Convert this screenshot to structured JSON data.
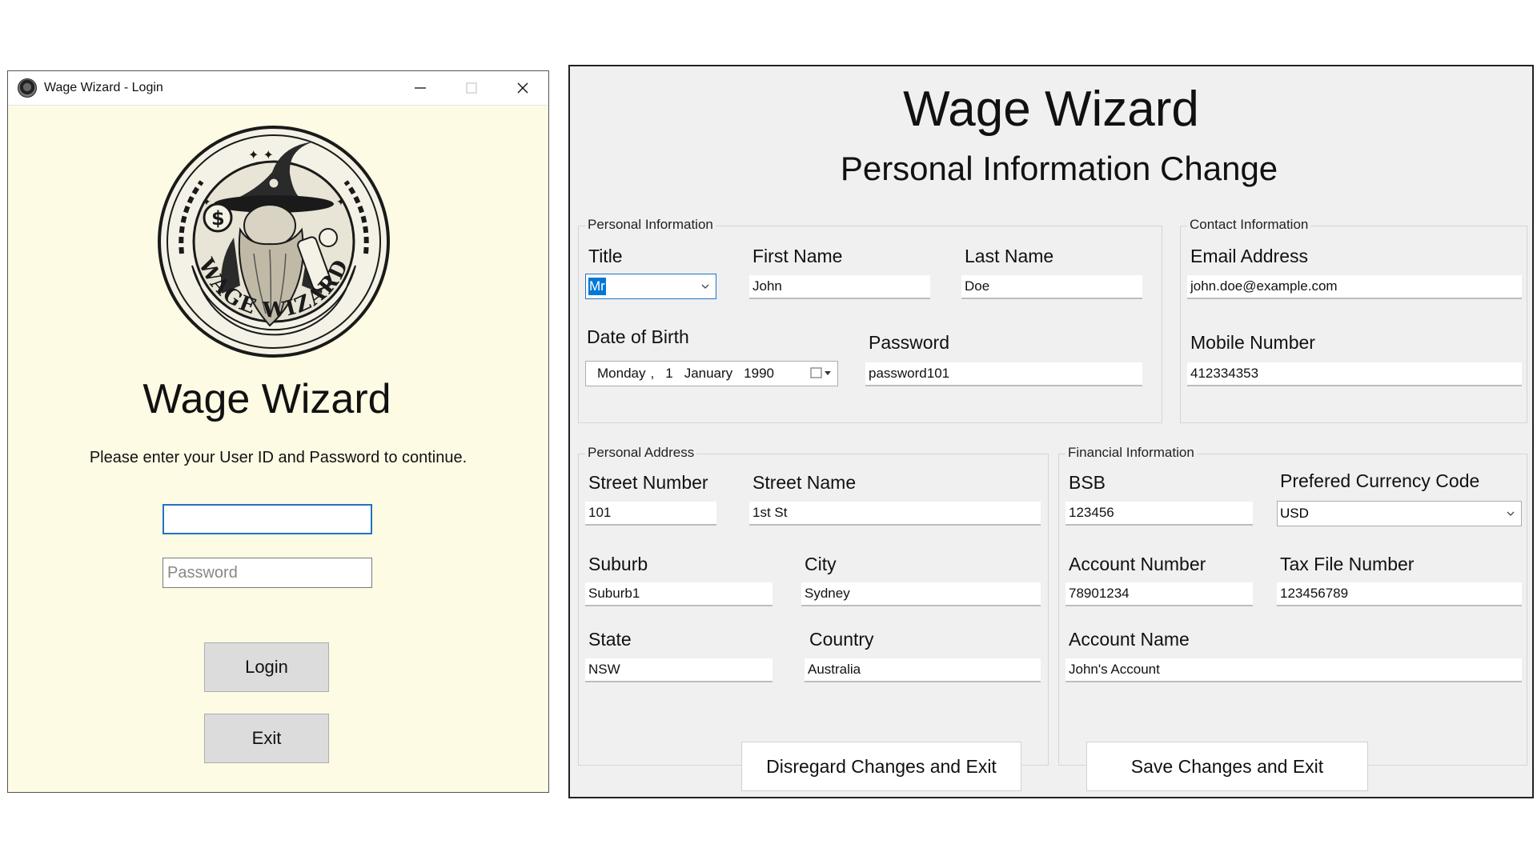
{
  "login": {
    "window_title": "Wage Wizard - Login",
    "logo_text": "WAGE WIZARD",
    "title": "Wage Wizard",
    "instructions": "Please enter your User ID and Password to continue.",
    "user_id_value": "",
    "password_placeholder": "Password",
    "login_label": "Login",
    "exit_label": "Exit"
  },
  "change": {
    "title": "Wage Wizard",
    "subtitle": "Personal Information Change",
    "personal_info": {
      "legend": "Personal Information",
      "title_label": "Title",
      "title_value": "Mr",
      "first_name_label": "First Name",
      "first_name_value": "John",
      "last_name_label": "Last Name",
      "last_name_value": "Doe",
      "dob_label": "Date of Birth",
      "dob_weekday": "Monday",
      "dob_day": "1",
      "dob_month": "January",
      "dob_year": "1990",
      "password_label": "Password",
      "password_value": "password101"
    },
    "contact_info": {
      "legend": "Contact Information",
      "email_label": "Email Address",
      "email_value": "john.doe@example.com",
      "mobile_label": "Mobile Number",
      "mobile_value": "412334353"
    },
    "address": {
      "legend": "Personal Address",
      "street_number_label": "Street Number",
      "street_number_value": "101",
      "street_name_label": "Street Name",
      "street_name_value": "1st St",
      "suburb_label": "Suburb",
      "suburb_value": "Suburb1",
      "city_label": "City",
      "city_value": "Sydney",
      "state_label": "State",
      "state_value": "NSW",
      "country_label": "Country",
      "country_value": "Australia"
    },
    "financial": {
      "legend": "Financial Information",
      "bsb_label": "BSB",
      "bsb_value": "123456",
      "currency_label": "Prefered Currency Code",
      "currency_value": "USD",
      "account_number_label": "Account Number",
      "account_number_value": "78901234",
      "tax_file_label": "Tax File Number",
      "tax_file_value": "123456789",
      "account_name_label": "Account Name",
      "account_name_value": "John's Account"
    },
    "disregard_label": "Disregard Changes and Exit",
    "save_label": "Save Changes and Exit"
  },
  "colors": {
    "login_background": "#fdfbe4",
    "form_background": "#f0f0f0",
    "focus_blue": "#1f73c8",
    "selection_blue": "#0078d7"
  }
}
